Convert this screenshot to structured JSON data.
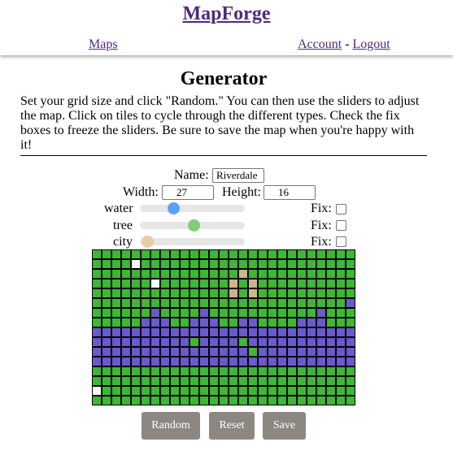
{
  "header": {
    "brand": "MapForge",
    "nav": {
      "maps": "Maps",
      "account": "Account",
      "separator": "-",
      "logout": "Logout"
    }
  },
  "page": {
    "title": "Generator",
    "intro": "Set your grid size and click \"Random.\" You can then use the sliders to adjust the map. Click on tiles to cycle through the different types. Check the fix boxes to freeze the sliders. Be sure to save the map when you're happy with it!"
  },
  "form": {
    "name_label": "Name:",
    "name_value": "Riverdale",
    "width_label": "Width:",
    "width_value": "27",
    "height_label": "Height:",
    "height_value": "16"
  },
  "sliders": [
    {
      "label": "water",
      "value": 0.32,
      "color": "#5aa0ff",
      "fix_label": "Fix:",
      "fixed": false
    },
    {
      "label": "tree",
      "value": 0.51,
      "color": "#7fcf7a",
      "fix_label": "Fix:",
      "fixed": false
    },
    {
      "label": "city",
      "value": 0.07,
      "color": "#e6cba6",
      "fix_label": "Fix:",
      "fixed": false
    }
  ],
  "tile_types": {
    "W": "water",
    "T": "tree",
    "C": "city",
    "E": "empty"
  },
  "colors": {
    "water": "#6a5acd",
    "tree": "#3cb832",
    "city": "#d2b48c",
    "empty": "#ffffff"
  },
  "grid": [
    "TTTTTTTTTTTTTTTTTTTTTTTTTTT",
    "TTTTETTTTTTTTTTTTTTTTTTTTTT",
    "TTTTTTTTTTTTTTTCTTTTTTTTTTT",
    "TTTTTTETTTTTTTCTCTTTTTTTTTT",
    "TTTTTTTTTTTTTTCTCTTTTTTTTTT",
    "TTTTTTTTTTTTTTTTTTTTTTTTTTW",
    "TTTTTTWTTTTWTTTTTTTTTTTWTTT",
    "TTTTTWWWTTWWWTTWWTTTTWWWTTT",
    "WWWWWWWWWWWWWWWWWWWWWWWWWWW",
    "WWWWWWWWWWTWWWWTWWWWWWWWWWW",
    "WWWWWWWWWWWWWWWWTWWWWWWWWWW",
    "WWWWWWWWWWWWWWWWWWWWWWWWWWW",
    "TTTTTTTTTTTTTTTTTTTTTTTTTTT",
    "TTTTTTTTTTTTTTTTTTTTTTTTTTT",
    "ETTTTTTTTTTTTTTTTTTTTTTTTTT",
    "TTTTTTTTTTTTTTTTTTTTTTTTTTT"
  ],
  "buttons": {
    "random": "Random",
    "reset": "Reset",
    "save": "Save"
  }
}
